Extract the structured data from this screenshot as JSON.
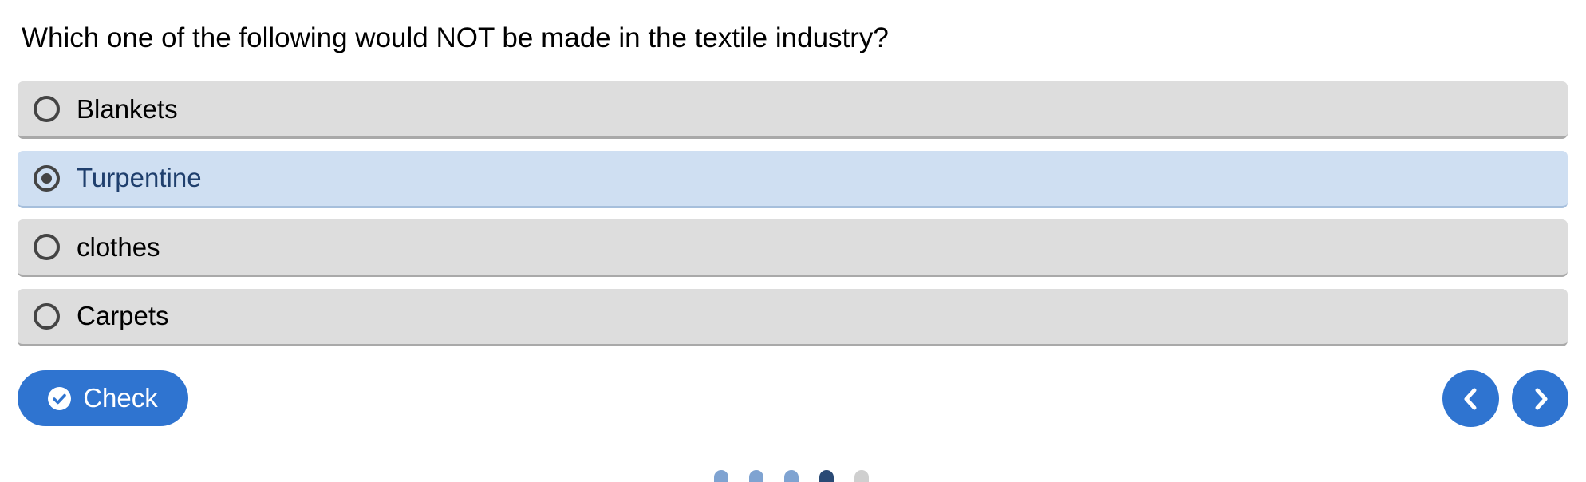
{
  "question": {
    "text": "Which one of the following would NOT be made in the textile industry?"
  },
  "options": [
    {
      "label": "Blankets",
      "selected": false
    },
    {
      "label": "Turpentine",
      "selected": true
    },
    {
      "label": "clothes",
      "selected": false
    },
    {
      "label": "Carpets",
      "selected": false
    }
  ],
  "actions": {
    "check_label": "Check",
    "check_icon": "check-circle-icon",
    "prev_icon": "chevron-left-icon",
    "next_icon": "chevron-right-icon"
  },
  "progress": {
    "total": 5,
    "current": 4
  },
  "colors": {
    "accent": "#2f74d0",
    "option_bg": "#dddddd",
    "selected_bg": "#cfdff2",
    "selected_text": "#1f3f6d"
  }
}
